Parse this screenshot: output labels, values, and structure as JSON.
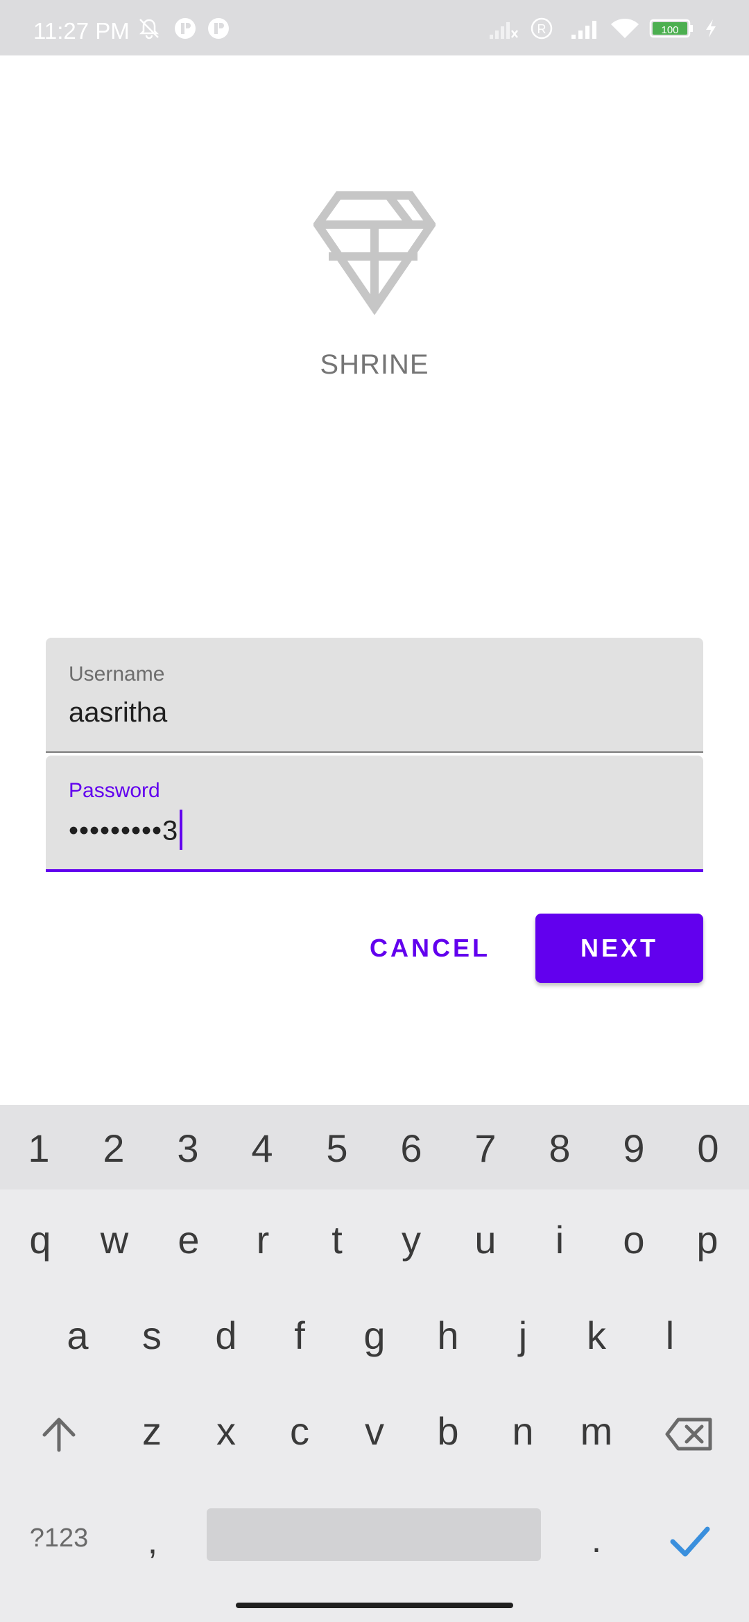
{
  "status_bar": {
    "time": "11:27 PM",
    "battery": "100",
    "icons": [
      "bell-off-icon",
      "app-notification-icon",
      "app-notification-icon",
      "signal-x-icon",
      "registered-icon",
      "signal-icon",
      "wifi-icon",
      "battery-icon",
      "charging-icon"
    ]
  },
  "app": {
    "brand": "SHRINE",
    "logo_icon": "diamond-icon",
    "accent_color": "#6200ee"
  },
  "form": {
    "username": {
      "label": "Username",
      "value": "aasritha"
    },
    "password": {
      "label": "Password",
      "value": "•••••••••3"
    }
  },
  "actions": {
    "cancel": "CANCEL",
    "next": "NEXT"
  },
  "keyboard": {
    "numbers": [
      "1",
      "2",
      "3",
      "4",
      "5",
      "6",
      "7",
      "8",
      "9",
      "0"
    ],
    "row1": [
      "q",
      "w",
      "e",
      "r",
      "t",
      "y",
      "u",
      "i",
      "o",
      "p"
    ],
    "row2": [
      "a",
      "s",
      "d",
      "f",
      "g",
      "h",
      "j",
      "k",
      "l"
    ],
    "row3": [
      "z",
      "x",
      "c",
      "v",
      "b",
      "n",
      "m"
    ],
    "symbols": "?123",
    "comma": ",",
    "period": ".",
    "shift_icon": "shift-icon",
    "backspace_icon": "backspace-icon",
    "enter_icon": "check-icon"
  }
}
